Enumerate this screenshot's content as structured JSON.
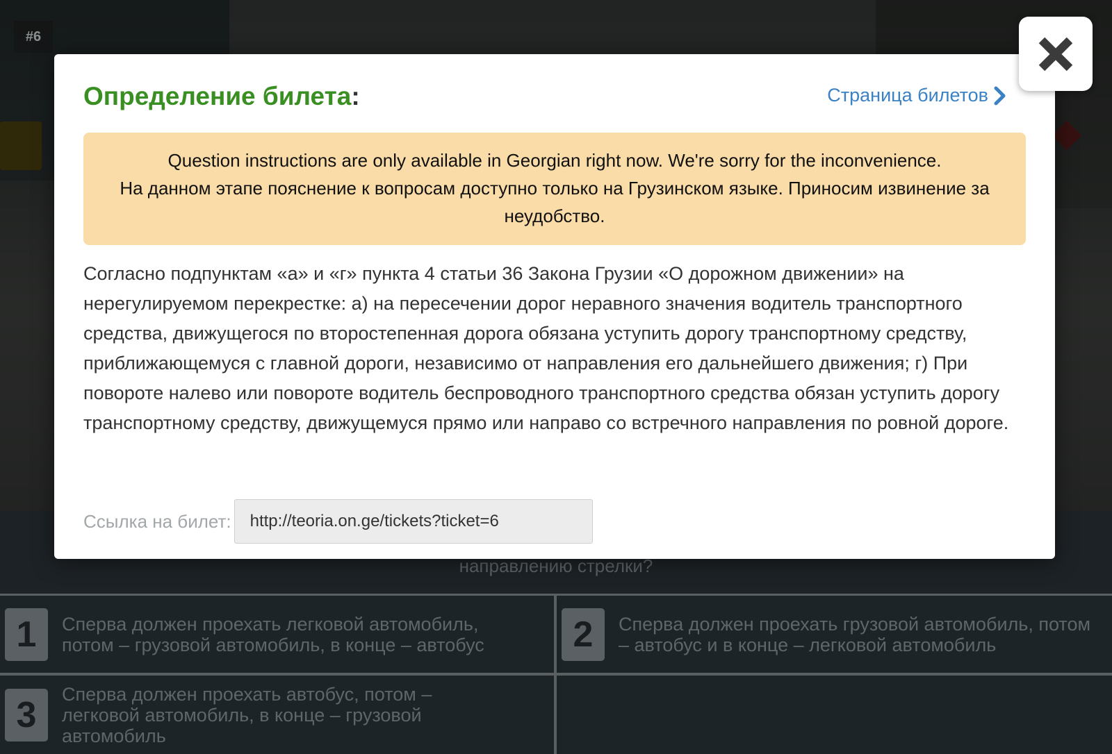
{
  "background": {
    "ticket_number": "#6",
    "question_partial": "направлению стрелки?"
  },
  "answers": [
    {
      "num": "1",
      "text": "Сперва должен проехать легковой автомобиль, потом – грузовой автомобиль, в конце – автобус"
    },
    {
      "num": "2",
      "text": "Сперва должен проехать грузовой автомобиль, потом – автобус и в конце – легковой автомобиль"
    },
    {
      "num": "3",
      "text": "Сперва должен проехать автобус, потом – легковой автомобиль, в конце – грузовой автомобиль"
    }
  ],
  "modal": {
    "title": "Определение билета",
    "title_colon": ":",
    "ticket_page_link": "Страница билетов",
    "notice_en": "Question instructions are only available in Georgian right now. We're sorry for the inconvenience.",
    "notice_ru": "На данном этапе пояснение к вопросам доступно только на Грузинском языке. Приносим извинение за неудобство.",
    "explanation": "Согласно подпунктам «а» и «г» пункта 4 статьи 36 Закона Грузии «О дорожном движении» на нерегулируемом перекрестке: а) на пересечении дорог неравного значения водитель транспортного средства, движущегося по второстепенная дорога обязана уступить дорогу транспортному средству, приближающемуся с главной дороги, независимо от направления его дальнейшего движения; г) При повороте налево или повороте водитель беспроводного транспортного средства обязан уступить дорогу транспортному средству, движущемуся прямо или направо со встречного направления по ровной дороге.",
    "link_label": "Ссылка на билет:",
    "link_value": "http://teoria.on.ge/tickets?ticket=6"
  },
  "colors": {
    "title_green": "#3a8f22",
    "link_blue": "#3a82c4",
    "notice_bg": "#fadca8"
  },
  "icons": {
    "close": "close-icon",
    "chevron": "chevron-right-icon"
  }
}
